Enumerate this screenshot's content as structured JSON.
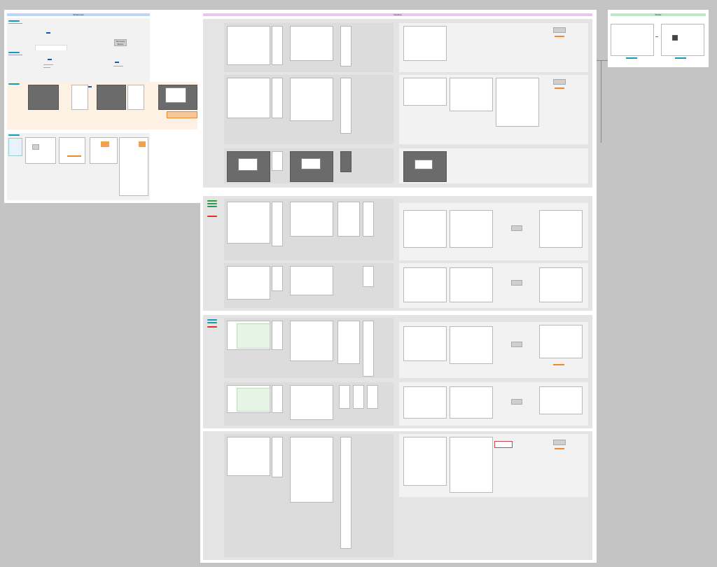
{
  "boards": {
    "left": {
      "label": "Wireframes"
    },
    "center": {
      "label": "Desktop"
    },
    "right": {
      "label": "Mobile"
    }
  },
  "placeholders": {
    "summary": "Summary Button",
    "details": "Details Drawer",
    "component": "Component",
    "section": "Section Name",
    "table": "Table Preview"
  },
  "colors": {
    "left_bar": "#bcd6f7",
    "center_bar": "#e7c7ef",
    "right_bar": "#bfe8c9",
    "accent": "#1358b8",
    "orange": "#e98a2e",
    "red": "#d8341b",
    "green": "#2e9b4a",
    "teal": "#159bb8"
  }
}
